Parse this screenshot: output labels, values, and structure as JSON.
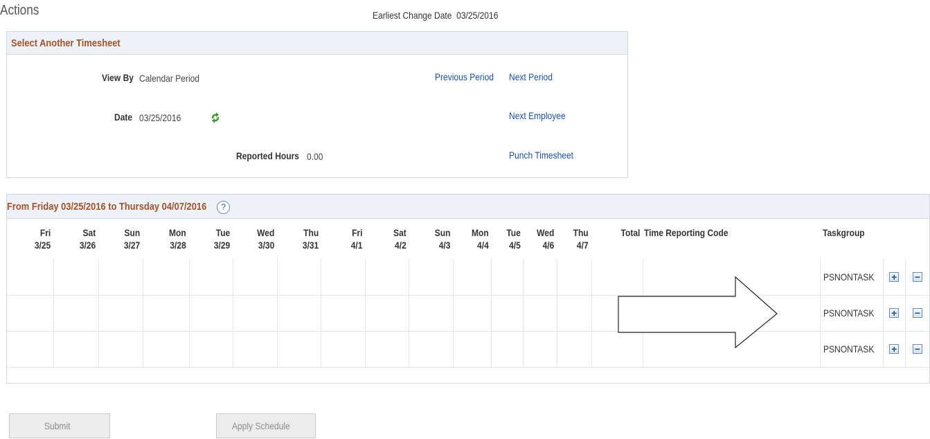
{
  "actions_label": "Actions",
  "earliest_change": {
    "label": "Earliest Change Date",
    "value": "03/25/2016"
  },
  "select_box": {
    "title": "Select Another Timesheet",
    "view_by_label": "View By",
    "view_by_value": "Calendar Period",
    "date_label": "Date",
    "date_value": "03/25/2016",
    "refresh_icon": "refresh-icon",
    "reported_hours_label": "Reported Hours",
    "reported_hours_value": "0.00",
    "previous_period": "Previous Period",
    "next_period": "Next Period",
    "next_employee": "Next Employee",
    "punch_timesheet": "Punch Timesheet"
  },
  "grid": {
    "title": "From Friday 03/25/2016 to Thursday 04/07/2016",
    "help_icon": "?",
    "days": [
      {
        "day": "Fri",
        "date": "3/25"
      },
      {
        "day": "Sat",
        "date": "3/26"
      },
      {
        "day": "Sun",
        "date": "3/27"
      },
      {
        "day": "Mon",
        "date": "3/28"
      },
      {
        "day": "Tue",
        "date": "3/29"
      },
      {
        "day": "Wed",
        "date": "3/30"
      },
      {
        "day": "Thu",
        "date": "3/31"
      },
      {
        "day": "Fri",
        "date": "4/1"
      },
      {
        "day": "Sat",
        "date": "4/2"
      },
      {
        "day": "Sun",
        "date": "4/3"
      },
      {
        "day": "Mon",
        "date": "4/4"
      },
      {
        "day": "Tue",
        "date": "4/5"
      },
      {
        "day": "Wed",
        "date": "4/6"
      },
      {
        "day": "Thu",
        "date": "4/7"
      }
    ],
    "total_header": "Total",
    "trc_header": "Time Reporting Code",
    "taskgroup_header": "Taskgroup",
    "rows": [
      {
        "taskgroup": "PSNONTASK",
        "add": "+",
        "remove": "−"
      },
      {
        "taskgroup": "PSNONTASK",
        "add": "+",
        "remove": "−"
      },
      {
        "taskgroup": "PSNONTASK",
        "add": "+",
        "remove": "−"
      }
    ]
  },
  "buttons": {
    "submit": "Submit",
    "apply_schedule": "Apply Schedule"
  },
  "colors": {
    "accent_title": "#a0522d",
    "link": "#1c4d9c",
    "refresh_green": "#3a9a2a"
  }
}
